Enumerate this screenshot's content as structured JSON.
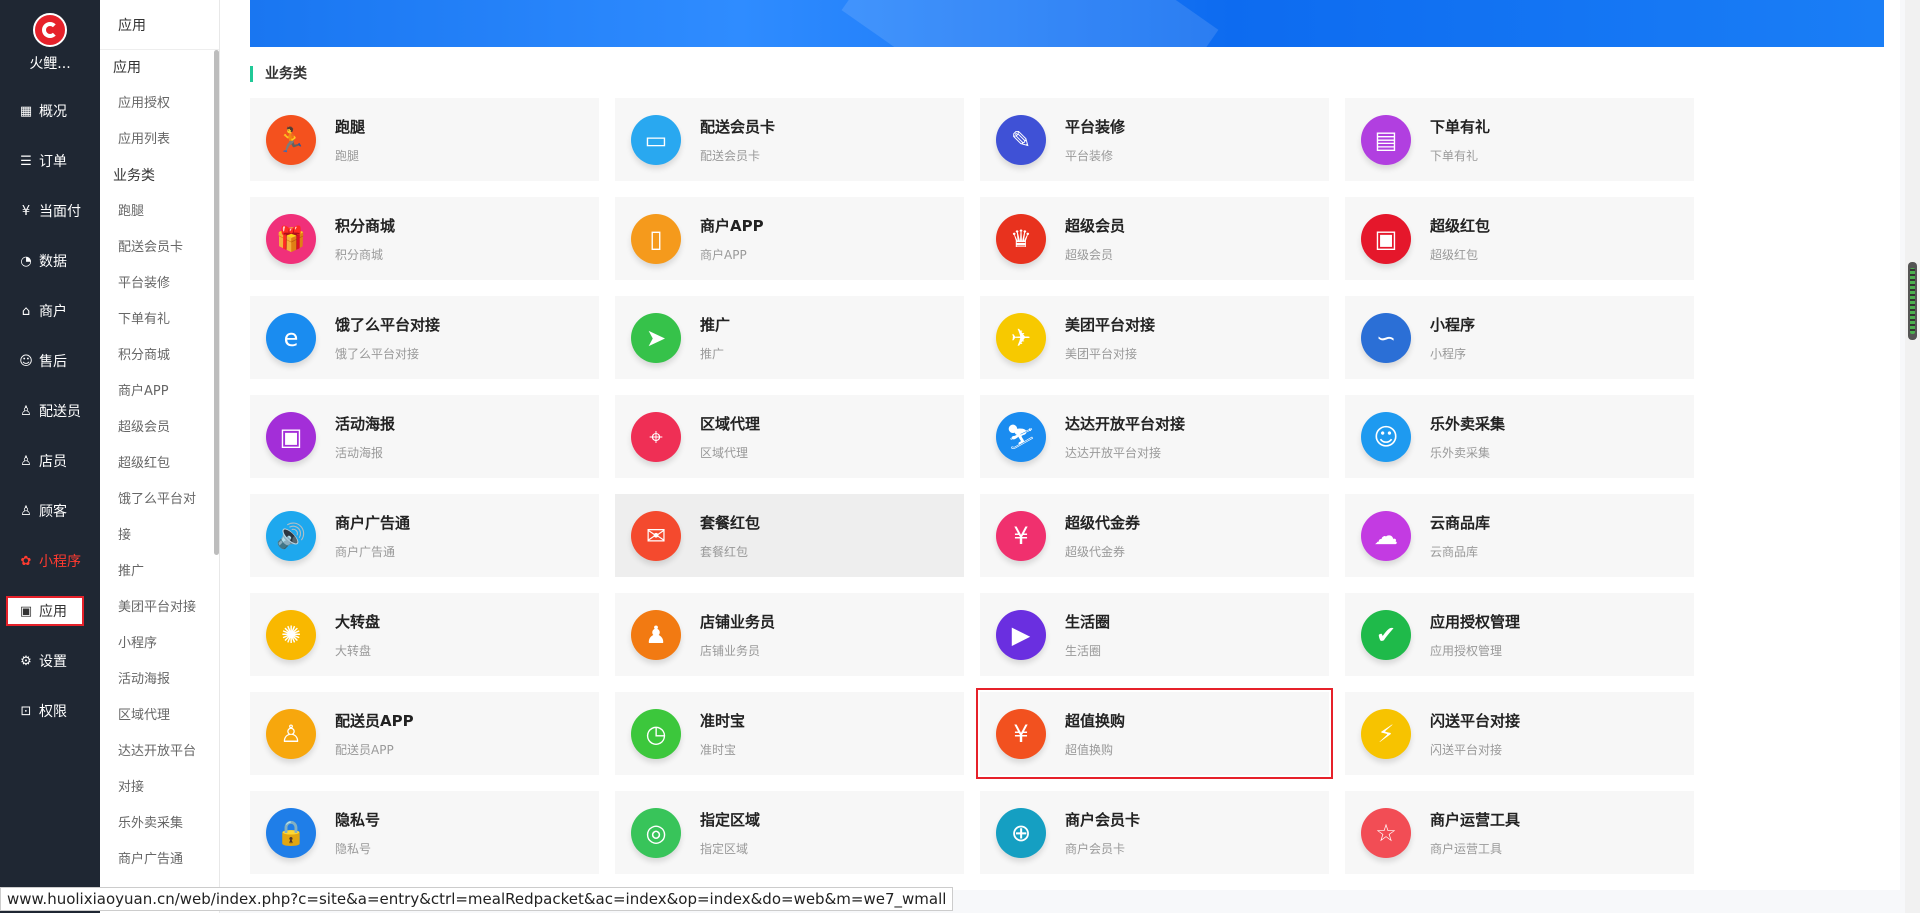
{
  "brand": {
    "name": "火鲤..."
  },
  "leftnav": [
    {
      "label": "概况",
      "icon": "dashboard-icon",
      "glyph": "▦"
    },
    {
      "label": "订单",
      "icon": "order-icon",
      "glyph": "☰"
    },
    {
      "label": "当面付",
      "icon": "payment-icon",
      "glyph": "¥"
    },
    {
      "label": "数据",
      "icon": "chart-icon",
      "glyph": "◔"
    },
    {
      "label": "商户",
      "icon": "store-icon",
      "glyph": "⌂"
    },
    {
      "label": "售后",
      "icon": "aftersale-icon",
      "glyph": "☺"
    },
    {
      "label": "配送员",
      "icon": "courier-icon",
      "glyph": "♙"
    },
    {
      "label": "店员",
      "icon": "clerk-icon",
      "glyph": "♙"
    },
    {
      "label": "顾客",
      "icon": "customer-icon",
      "glyph": "♙"
    },
    {
      "label": "小程序",
      "icon": "miniprogram-icon",
      "glyph": "✿",
      "red": true
    },
    {
      "label": "应用",
      "icon": "apps-icon",
      "glyph": "▣",
      "active": true
    },
    {
      "label": "设置",
      "icon": "gear-icon",
      "glyph": "⚙"
    },
    {
      "label": "权限",
      "icon": "lock-icon",
      "glyph": "⊡"
    }
  ],
  "subnav": {
    "top": "应用",
    "groups": [
      {
        "title": "应用",
        "items": [
          "应用授权",
          "应用列表"
        ]
      },
      {
        "title": "业务类",
        "items": [
          "跑腿",
          "配送会员卡",
          "平台装修",
          "下单有礼",
          "积分商城",
          "商户APP",
          "超级会员",
          "超级红包",
          "饿了么平台对",
          "接",
          "推广",
          "美团平台对接",
          "小程序",
          "活动海报",
          "区域代理",
          "达达开放平台",
          "对接",
          "乐外卖采集",
          "商户广告通"
        ]
      }
    ]
  },
  "section_title": "业务类",
  "cards": [
    {
      "title": "跑腿",
      "sub": "跑腿",
      "color": "#f4511e",
      "glyph": "🏃",
      "icon": "run-icon"
    },
    {
      "title": "配送会员卡",
      "sub": "配送会员卡",
      "color": "#29a8f0",
      "glyph": "▭",
      "icon": "vip-card-icon"
    },
    {
      "title": "平台装修",
      "sub": "平台装修",
      "color": "#3f51d6",
      "glyph": "✎",
      "icon": "brush-icon"
    },
    {
      "title": "下单有礼",
      "sub": "下单有礼",
      "color": "#b13fe0",
      "glyph": "▤",
      "icon": "wallet-icon"
    },
    {
      "title": "积分商城",
      "sub": "积分商城",
      "color": "#f0307a",
      "glyph": "🎁",
      "icon": "gift-icon"
    },
    {
      "title": "商户APP",
      "sub": "商户APP",
      "color": "#f59a1c",
      "glyph": "▯",
      "icon": "phone-icon"
    },
    {
      "title": "超级会员",
      "sub": "超级会员",
      "color": "#e8321e",
      "glyph": "♛",
      "icon": "member-icon"
    },
    {
      "title": "超级红包",
      "sub": "超级红包",
      "color": "#e5172b",
      "glyph": "▣",
      "icon": "redpacket-icon"
    },
    {
      "title": "饿了么平台对接",
      "sub": "饿了么平台对接",
      "color": "#1a8cf0",
      "glyph": "e",
      "icon": "eleme-icon"
    },
    {
      "title": "推广",
      "sub": "推广",
      "color": "#36c24a",
      "glyph": "➤",
      "icon": "paper-plane-icon"
    },
    {
      "title": "美团平台对接",
      "sub": "美团平台对接",
      "color": "#f7c900",
      "glyph": "✈",
      "icon": "meituan-icon"
    },
    {
      "title": "小程序",
      "sub": "小程序",
      "color": "#2b6fd6",
      "glyph": "∽",
      "icon": "miniprogram-icon"
    },
    {
      "title": "活动海报",
      "sub": "活动海报",
      "color": "#a32ed8",
      "glyph": "▣",
      "icon": "poster-icon"
    },
    {
      "title": "区域代理",
      "sub": "区域代理",
      "color": "#ef2f55",
      "glyph": "⌖",
      "icon": "map-pin-icon"
    },
    {
      "title": "达达开放平台对接",
      "sub": "达达开放平台对接",
      "color": "#1a8cf0",
      "glyph": "⛷",
      "icon": "dada-icon"
    },
    {
      "title": "乐外卖采集",
      "sub": "乐外卖采集",
      "color": "#1e9af0",
      "glyph": "☺",
      "icon": "lewaimai-icon"
    },
    {
      "title": "商户广告通",
      "sub": "商户广告通",
      "color": "#1ea8ee",
      "glyph": "🔊",
      "icon": "speaker-icon"
    },
    {
      "title": "套餐红包",
      "sub": "套餐红包",
      "color": "#f44a2e",
      "glyph": "✉",
      "icon": "package-redpacket-icon",
      "hover": true
    },
    {
      "title": "超级代金券",
      "sub": "超级代金券",
      "color": "#f0306e",
      "glyph": "¥",
      "icon": "coupon-icon"
    },
    {
      "title": "云商品库",
      "sub": "云商品库",
      "color": "#c33be2",
      "glyph": "☁",
      "icon": "cloud-icon"
    },
    {
      "title": "大转盘",
      "sub": "大转盘",
      "color": "#f9b800",
      "glyph": "✺",
      "icon": "wheel-icon"
    },
    {
      "title": "店铺业务员",
      "sub": "店铺业务员",
      "color": "#f27a12",
      "glyph": "♟",
      "icon": "salesman-icon"
    },
    {
      "title": "生活圈",
      "sub": "生活圈",
      "color": "#6a2fe0",
      "glyph": "▶",
      "icon": "play-icon"
    },
    {
      "title": "应用授权管理",
      "sub": "应用授权管理",
      "color": "#1fba4a",
      "glyph": "✔",
      "icon": "shield-icon"
    },
    {
      "title": "配送员APP",
      "sub": "配送员APP",
      "color": "#f7a70d",
      "glyph": "♙",
      "icon": "courier-app-icon"
    },
    {
      "title": "准时宝",
      "sub": "准时宝",
      "color": "#3cc73c",
      "glyph": "◷",
      "icon": "clock-icon"
    },
    {
      "title": "超值换购",
      "sub": "超值换购",
      "color": "#f2511f",
      "glyph": "¥",
      "icon": "exchange-icon",
      "selected": true
    },
    {
      "title": "闪送平台对接",
      "sub": "闪送平台对接",
      "color": "#f7c300",
      "glyph": "⚡",
      "icon": "flash-icon"
    },
    {
      "title": "隐私号",
      "sub": "隐私号",
      "color": "#1f7ee8",
      "glyph": "🔒",
      "icon": "lock-icon"
    },
    {
      "title": "指定区域",
      "sub": "指定区域",
      "color": "#38c45a",
      "glyph": "◎",
      "icon": "area-icon"
    },
    {
      "title": "商户会员卡",
      "sub": "商户会员卡",
      "color": "#159fc2",
      "glyph": "⊕",
      "icon": "globe-icon"
    },
    {
      "title": "商户运营工具",
      "sub": "商户运营工具",
      "color": "#f24d55",
      "glyph": "☆",
      "icon": "star-icon"
    }
  ],
  "statusbar": {
    "url": "www.huolixiaoyuan.cn/web/index.php?c=site&a=entry&ctrl=mealRedpacket&ac=index&op=index&do=web&m=we7_wmall"
  }
}
